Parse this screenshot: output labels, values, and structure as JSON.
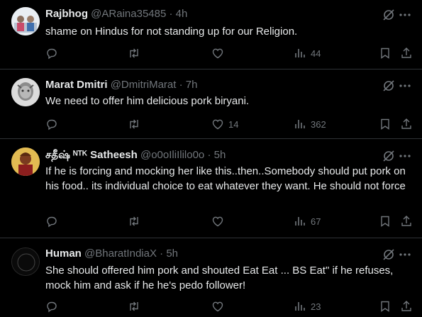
{
  "tweets": [
    {
      "name": "Rajbhog",
      "handle": "@ARaina35485",
      "dot": "·",
      "time": "4h",
      "text": "shame on Hindus for not standing up for our Religion.",
      "replies": "",
      "reposts": "",
      "likes": "",
      "views": "44"
    },
    {
      "name": "Marat Dmitri",
      "handle": "@DmitriMarat",
      "dot": "·",
      "time": "7h",
      "text": "We need to offer him delicious pork biryani.",
      "replies": "",
      "reposts": "",
      "likes": "14",
      "views": "362"
    },
    {
      "name": "சதீஷ் ᴺᵀᴷ Satheesh",
      "handle": "@o0oIliIlilo0o",
      "dot": "·",
      "time": "5h",
      "text": "If he is forcing and mocking her like this..then..Somebody should put pork on his food..  its individual choice to eat whatever they want. He should not force",
      "replies": "",
      "reposts": "",
      "likes": "",
      "views": "67"
    },
    {
      "name": "Human",
      "handle": "@BharatIndiaX",
      "dot": "·",
      "time": "5h",
      "text": "She should offered him pork and shouted Eat Eat ... BS Eat\" if he refuses, mock him and ask if he he's pedo follower!",
      "replies": "",
      "reposts": "",
      "likes": "",
      "views": "23"
    }
  ],
  "icons": {
    "reply": "reply-icon",
    "repost": "repost-icon",
    "like": "like-icon",
    "views": "views-icon",
    "bookmark": "bookmark-icon",
    "share": "share-icon",
    "grok": "grok-icon",
    "more": "more-icon"
  },
  "colors": {
    "background": "#000000",
    "text": "#e7e9ea",
    "muted": "#71767b",
    "divider": "#2f3336"
  }
}
